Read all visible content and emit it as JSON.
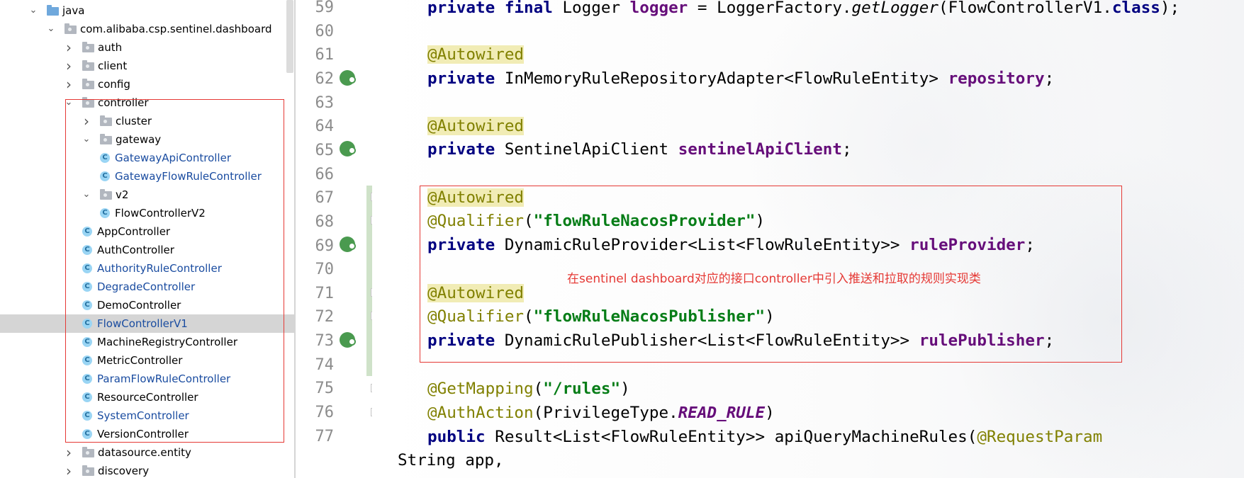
{
  "tree": {
    "items": [
      {
        "label": "java",
        "kind": "folder",
        "expanded": true,
        "icon": "source-folder-icon"
      },
      {
        "label": "com.alibaba.csp.sentinel.dashboard",
        "kind": "package",
        "expanded": true,
        "icon": "package-icon"
      },
      {
        "label": "auth",
        "kind": "package",
        "expanded": false,
        "icon": "package-icon"
      },
      {
        "label": "client",
        "kind": "package",
        "expanded": false,
        "icon": "package-icon"
      },
      {
        "label": "config",
        "kind": "package",
        "expanded": false,
        "icon": "package-icon"
      },
      {
        "label": "controller",
        "kind": "package",
        "expanded": true,
        "icon": "package-icon"
      },
      {
        "label": "cluster",
        "kind": "package",
        "expanded": false,
        "icon": "package-icon"
      },
      {
        "label": "gateway",
        "kind": "package",
        "expanded": true,
        "icon": "package-icon"
      },
      {
        "label": "GatewayApiController",
        "kind": "class",
        "modified": true,
        "icon": "class-icon"
      },
      {
        "label": "GatewayFlowRuleController",
        "kind": "class",
        "modified": true,
        "icon": "class-icon"
      },
      {
        "label": "v2",
        "kind": "package",
        "expanded": true,
        "icon": "package-icon"
      },
      {
        "label": "FlowControllerV2",
        "kind": "class",
        "modified": false,
        "icon": "class-icon"
      },
      {
        "label": "AppController",
        "kind": "class",
        "modified": false,
        "icon": "class-icon"
      },
      {
        "label": "AuthController",
        "kind": "class",
        "modified": false,
        "icon": "class-icon"
      },
      {
        "label": "AuthorityRuleController",
        "kind": "class",
        "modified": true,
        "icon": "class-icon"
      },
      {
        "label": "DegradeController",
        "kind": "class",
        "modified": true,
        "icon": "class-icon"
      },
      {
        "label": "DemoController",
        "kind": "class",
        "modified": false,
        "icon": "class-icon"
      },
      {
        "label": "FlowControllerV1",
        "kind": "class",
        "modified": true,
        "selected": true,
        "icon": "class-icon"
      },
      {
        "label": "MachineRegistryController",
        "kind": "class",
        "modified": false,
        "icon": "class-icon"
      },
      {
        "label": "MetricController",
        "kind": "class",
        "modified": false,
        "icon": "class-icon"
      },
      {
        "label": "ParamFlowRuleController",
        "kind": "class",
        "modified": true,
        "icon": "class-icon"
      },
      {
        "label": "ResourceController",
        "kind": "class",
        "modified": false,
        "icon": "class-icon"
      },
      {
        "label": "SystemController",
        "kind": "class",
        "modified": true,
        "icon": "class-icon"
      },
      {
        "label": "VersionController",
        "kind": "class",
        "modified": false,
        "icon": "class-icon"
      },
      {
        "label": "datasource.entity",
        "kind": "package",
        "expanded": false,
        "icon": "package-icon"
      },
      {
        "label": "discovery",
        "kind": "package",
        "expanded": false,
        "icon": "package-icon"
      }
    ]
  },
  "editor": {
    "line_numbers": [
      "59",
      "60",
      "61",
      "62",
      "63",
      "64",
      "65",
      "66",
      "67",
      "68",
      "69",
      "70",
      "71",
      "72",
      "73",
      "74",
      "75",
      "76",
      "77"
    ],
    "code": {
      "l59": {
        "kw1": "private final ",
        "type": "Logger ",
        "field": "logger",
        "eq": " = LoggerFactory.",
        "method": "getLogger",
        "open": "(FlowControllerV1.",
        "cls": "class",
        "close": ");"
      },
      "l61": {
        "ann": "@Autowired"
      },
      "l62": {
        "kw": "private ",
        "type": "InMemoryRuleRepositoryAdapter<FlowRuleEntity> ",
        "field": "repository",
        "end": ";"
      },
      "l64": {
        "ann": "@Autowired"
      },
      "l65": {
        "kw": "private ",
        "type": "SentinelApiClient ",
        "field": "sentinelApiClient",
        "end": ";"
      },
      "l67": {
        "ann": "@Autowired"
      },
      "l68": {
        "ann": "@Qualifier",
        "open": "(",
        "str": "\"flowRuleNacosProvider\"",
        "close": ")"
      },
      "l69": {
        "kw": "private ",
        "type": "DynamicRuleProvider<List<FlowRuleEntity>> ",
        "field": "ruleProvider",
        "end": ";"
      },
      "l71": {
        "ann": "@Autowired"
      },
      "l72": {
        "ann": "@Qualifier",
        "open": "(",
        "str": "\"flowRuleNacosPublisher\"",
        "close": ")"
      },
      "l73": {
        "kw": "private ",
        "type": "DynamicRulePublisher<List<FlowRuleEntity>> ",
        "field": "rulePublisher",
        "end": ";"
      },
      "l75": {
        "ann": "@GetMapping",
        "open": "(",
        "str": "\"/rules\"",
        "close": ")"
      },
      "l76": {
        "ann": "@AuthAction",
        "open": "(PrivilegeType.",
        "const": "READ_RULE",
        "close": ")"
      },
      "l77": {
        "kw": "public ",
        "type": "Result<List<FlowRuleEntity>> apiQueryMachineRules(",
        "ann": "@RequestParam"
      },
      "l77b": {
        "text": "String app,"
      }
    },
    "gutter_icons": [
      "bean-icon"
    ],
    "annotation_note": "在sentinel dashboard对应的接口controller中引入推送和拉取的规则实现类"
  },
  "colors": {
    "keyword": "#000080",
    "annotation": "#808000",
    "field": "#660e7a",
    "string": "#067d17",
    "highlight_box": "#e53935",
    "modified_file": "#1a4ca0"
  }
}
